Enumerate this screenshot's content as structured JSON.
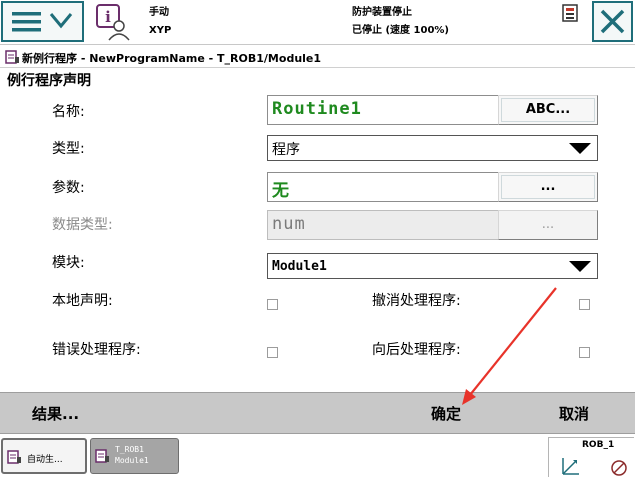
{
  "topbar": {
    "mode": "手动",
    "controller": "XYP",
    "safety_state": "防护装置停止",
    "run_state": "已停止 (速度 100%)"
  },
  "breadcrumb": "新例行程序 - NewProgramName - T_ROB1/Module1",
  "section_title": "例行程序声明",
  "form": {
    "name_label": "名称:",
    "name_value": "Routine1",
    "name_button": "ABC...",
    "type_label": "类型:",
    "type_value": "程序",
    "params_label": "参数:",
    "params_value": "无",
    "params_button": "...",
    "datatype_label": "数据类型:",
    "datatype_value": "num",
    "datatype_button": "...",
    "module_label": "模块:",
    "module_value": "Module1",
    "local_label": "本地声明:",
    "undo_label": "撤消处理程序:",
    "error_label": "错误处理程序:",
    "backward_label": "向后处理程序:"
  },
  "commands": {
    "results": "结果...",
    "ok": "确定",
    "cancel": "取消"
  },
  "taskbar": {
    "task1": "自动生...",
    "task2_line1": "T_ROB1",
    "task2_line2": "Module1",
    "robot": "ROB_1"
  },
  "colors": {
    "accent": "#1f6e7a",
    "value_green": "#1f8a1f",
    "annotation_red": "#e8332a",
    "command_bar": "#c8c8c8"
  }
}
